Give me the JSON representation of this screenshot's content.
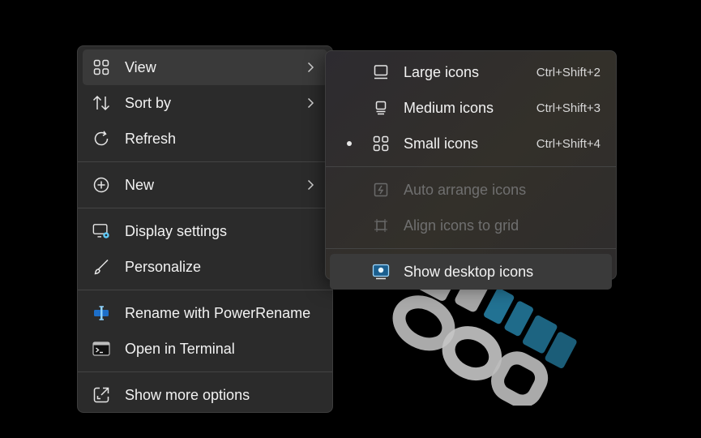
{
  "context_menu": {
    "items": [
      {
        "label": "View",
        "icon": "grid-icon",
        "submenu": true
      },
      {
        "label": "Sort by",
        "icon": "sort-arrows-icon",
        "submenu": true
      },
      {
        "label": "Refresh",
        "icon": "refresh-icon"
      },
      {
        "label": "New",
        "icon": "plus-circle-icon",
        "submenu": true
      },
      {
        "label": "Display settings",
        "icon": "display-settings-icon"
      },
      {
        "label": "Personalize",
        "icon": "brush-icon"
      },
      {
        "label": "Rename with PowerRename",
        "icon": "powerrename-icon"
      },
      {
        "label": "Open in Terminal",
        "icon": "terminal-icon"
      },
      {
        "label": "Show more options",
        "icon": "expand-icon"
      }
    ]
  },
  "view_submenu": {
    "items": [
      {
        "label": "Large icons",
        "shortcut": "Ctrl+Shift+2",
        "icon": "large-icons-icon"
      },
      {
        "label": "Medium icons",
        "shortcut": "Ctrl+Shift+3",
        "icon": "medium-icons-icon"
      },
      {
        "label": "Small icons",
        "shortcut": "Ctrl+Shift+4",
        "icon": "small-icons-icon",
        "selected": true
      },
      {
        "label": "Auto arrange icons",
        "icon": "auto-arrange-icon",
        "disabled": true
      },
      {
        "label": "Align icons to grid",
        "icon": "align-grid-icon",
        "disabled": true
      },
      {
        "label": "Show desktop icons",
        "icon": "show-desktop-icon"
      }
    ]
  },
  "colors": {
    "menu_bg": "#2b2b2b",
    "accent": "#60cdff",
    "text": "#f2f2f2",
    "disabled_text": "#6f6f6f"
  }
}
